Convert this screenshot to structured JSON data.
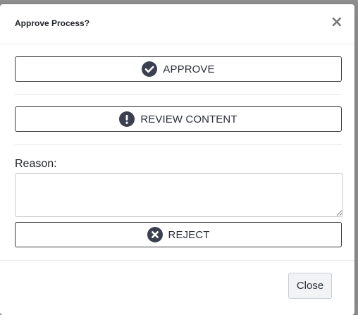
{
  "modal": {
    "title": "Approve Process?",
    "close_glyph": "×"
  },
  "actions": {
    "approve": {
      "label": "APPROVE",
      "icon": "check-circle-icon"
    },
    "review": {
      "label": "REVIEW CONTENT",
      "icon": "exclamation-circle-icon"
    },
    "reject": {
      "label": "REJECT",
      "icon": "x-circle-icon"
    }
  },
  "reason": {
    "label": "Reason:",
    "value": "",
    "placeholder": ""
  },
  "footer": {
    "close_label": "Close"
  },
  "colors": {
    "icon_fill": "#3b4050",
    "button_border": "#3a3a3a",
    "overlay": "#9a9a9a"
  }
}
